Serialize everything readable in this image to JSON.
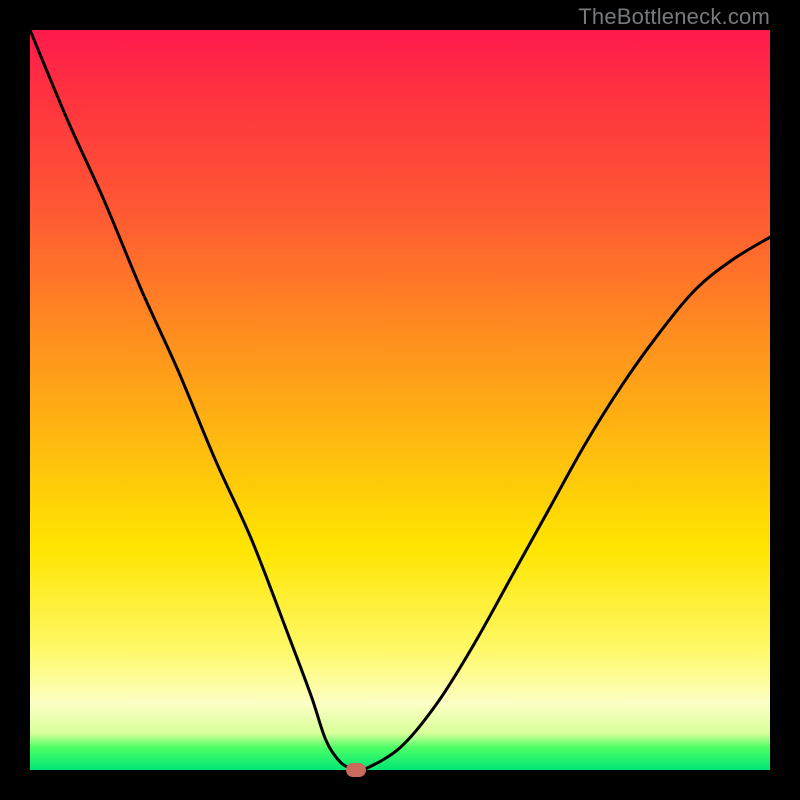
{
  "watermark": "TheBottleneck.com",
  "chart_data": {
    "type": "line",
    "title": "",
    "xlabel": "",
    "ylabel": "",
    "xlim": [
      0,
      100
    ],
    "ylim": [
      0,
      100
    ],
    "series": [
      {
        "name": "curve",
        "x": [
          0,
          5,
          10,
          15,
          20,
          25,
          30,
          35,
          38,
          40,
          42,
          44,
          45,
          50,
          55,
          60,
          65,
          70,
          75,
          80,
          85,
          90,
          95,
          100
        ],
        "y": [
          100,
          88,
          77,
          65,
          54,
          42,
          31,
          18,
          10,
          4,
          1,
          0,
          0,
          3,
          9,
          17,
          26,
          35,
          44,
          52,
          59,
          65,
          69,
          72
        ]
      }
    ],
    "marker": {
      "x": 44,
      "y": 0,
      "color": "#c96a5a"
    },
    "gradient_stops": [
      {
        "pct": 0,
        "color": "#ff1a4d"
      },
      {
        "pct": 25,
        "color": "#ff5a33"
      },
      {
        "pct": 55,
        "color": "#ffb810"
      },
      {
        "pct": 84,
        "color": "#fff96a"
      },
      {
        "pct": 100,
        "color": "#00e676"
      }
    ]
  }
}
